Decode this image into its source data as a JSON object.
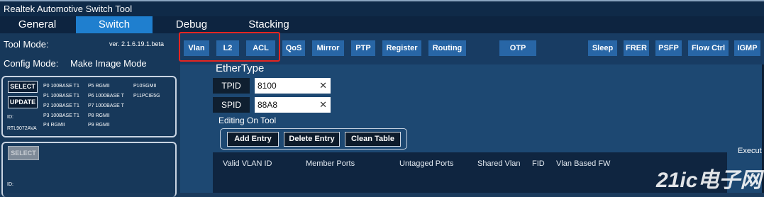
{
  "window": {
    "title": "Realtek Automotive Switch Tool"
  },
  "main_tabs": [
    {
      "label": "General",
      "active": false
    },
    {
      "label": "Switch",
      "active": true
    },
    {
      "label": "Debug",
      "active": false
    },
    {
      "label": "Stacking",
      "active": false
    }
  ],
  "left_panel": {
    "tool_mode_label": "Tool Mode:",
    "version": "ver. 2.1.6.19.1.beta",
    "config_mode_label": "Config Mode:",
    "config_mode_value": "Make Image Mode",
    "select_label": "SELECT",
    "update_label": "UPDATE",
    "id_label": "ID:",
    "device_id": "RTL9072AVA",
    "ports": [
      "P0  100BASE T1",
      "P5  RGMII",
      "P10SGMII",
      "P1  100BASE T1",
      "P6  1000BASE T",
      "P11PCIE5G",
      "P2  100BASE T1",
      "P7  1000BASE T",
      "P3  100BASE T1",
      "P8  RGMII",
      "P4  RGMII",
      "P9  RGMII"
    ],
    "select2_label": "SELECT",
    "id2_label": "ID:"
  },
  "sub_tabs": [
    "Vlan",
    "L2",
    "ACL",
    "QoS",
    "Mirror",
    "PTP",
    "Register",
    "Routing",
    "OTP",
    "Sleep",
    "FRER",
    "PSFP",
    "Flow Ctrl",
    "IGMP"
  ],
  "content": {
    "section_title": "EtherType",
    "tpid_label": "TPID",
    "tpid_value": "8100",
    "spid_label": "SPID",
    "spid_value": "88A8",
    "clear_glyph": "✕",
    "editing_label": "Editing On Tool",
    "buttons": {
      "add": "Add Entry",
      "delete": "Delete Entry",
      "clean": "Clean Table"
    },
    "execute_label": "Executi",
    "table_headers": [
      "Valid VLAN ID",
      "Member Ports",
      "Untagged Ports",
      "Shared Vlan",
      "FID",
      "Vlan Based FW"
    ]
  },
  "watermark": "21ic电子网",
  "colors": {
    "accent": "#1f7fcf",
    "highlight": "#e52520",
    "tab": "#2866a6"
  }
}
